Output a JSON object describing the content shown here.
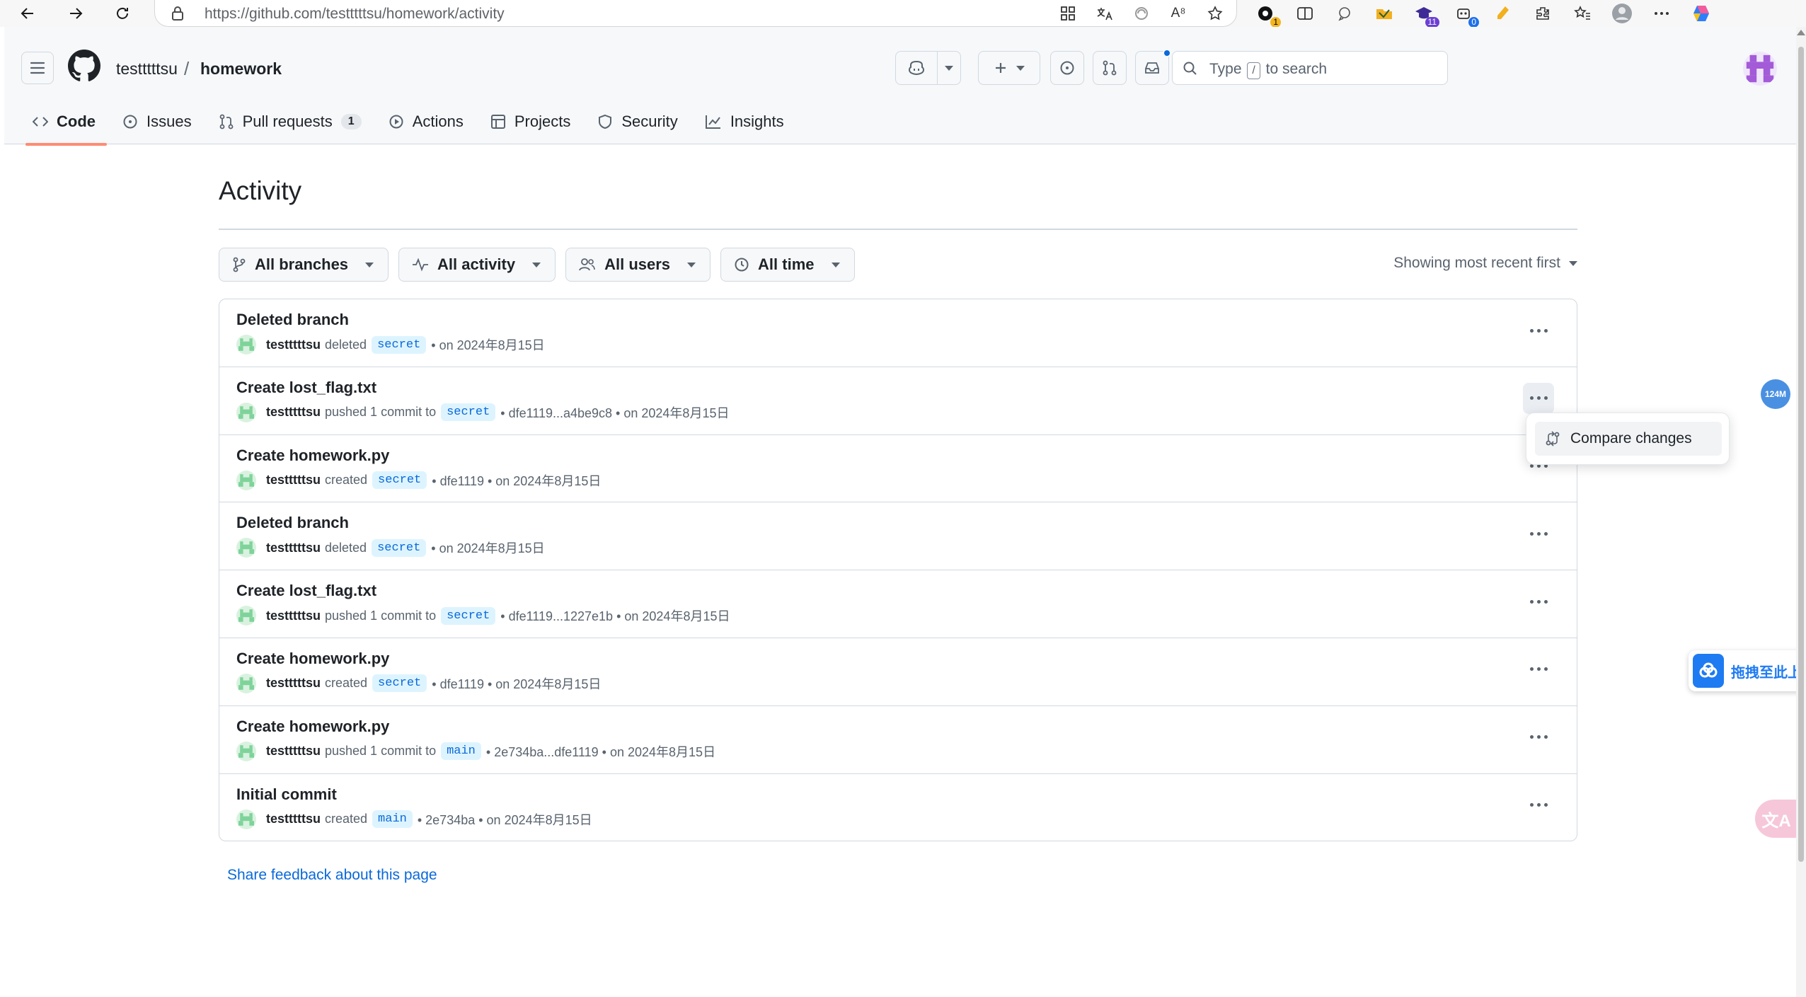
{
  "browser": {
    "url": "https://github.com/testttttsu/homework/activity",
    "ext_badges": [
      "1",
      "11",
      "0"
    ],
    "read_aloud_glyph": "A⁸"
  },
  "header": {
    "owner": "testttttsu",
    "separator": "/",
    "repo": "homework",
    "search_type": "Type",
    "search_key": "/",
    "search_rest": "to search"
  },
  "tabs": [
    {
      "label": "Code",
      "icon": "code-icon",
      "selected": true
    },
    {
      "label": "Issues",
      "icon": "issue-opened-icon"
    },
    {
      "label": "Pull requests",
      "icon": "git-pull-request-icon",
      "count": "1"
    },
    {
      "label": "Actions",
      "icon": "play-icon"
    },
    {
      "label": "Projects",
      "icon": "table-icon"
    },
    {
      "label": "Security",
      "icon": "shield-icon"
    },
    {
      "label": "Insights",
      "icon": "graph-icon"
    }
  ],
  "page": {
    "title": "Activity",
    "filters": [
      "All branches",
      "All activity",
      "All users",
      "All time"
    ],
    "sort": "Showing most recent first",
    "feedback": "Share feedback about this page"
  },
  "activity": [
    {
      "title": "Deleted branch",
      "user": "testttttsu",
      "action": "deleted",
      "branch": "secret",
      "detail": "• on 2024年8月15日"
    },
    {
      "title": "Create lost_flag.txt",
      "user": "testttttsu",
      "action": "pushed 1 commit to",
      "branch": "secret",
      "detail": "• dfe1119...a4be9c8 • on 2024年8月15日"
    },
    {
      "title": "Create homework.py",
      "user": "testttttsu",
      "action": "created",
      "branch": "secret",
      "detail": "• dfe1119 • on 2024年8月15日"
    },
    {
      "title": "Deleted branch",
      "user": "testttttsu",
      "action": "deleted",
      "branch": "secret",
      "detail": "• on 2024年8月15日"
    },
    {
      "title": "Create lost_flag.txt",
      "user": "testttttsu",
      "action": "pushed 1 commit to",
      "branch": "secret",
      "detail": "• dfe1119...1227e1b • on 2024年8月15日"
    },
    {
      "title": "Create homework.py",
      "user": "testttttsu",
      "action": "created",
      "branch": "secret",
      "detail": "• dfe1119 • on 2024年8月15日"
    },
    {
      "title": "Create homework.py",
      "user": "testttttsu",
      "action": "pushed 1 commit to",
      "branch": "main",
      "detail": "• 2e734ba...dfe1119 • on 2024年8月15日"
    },
    {
      "title": "Initial commit",
      "user": "testttttsu",
      "action": "created",
      "branch": "main",
      "detail": "• 2e734ba • on 2024年8月15日"
    }
  ],
  "menu": {
    "item": "Compare changes"
  },
  "floating": {
    "size_badge": "124M",
    "upload_text": "拖拽至此上",
    "translate_glyph": "文A"
  }
}
